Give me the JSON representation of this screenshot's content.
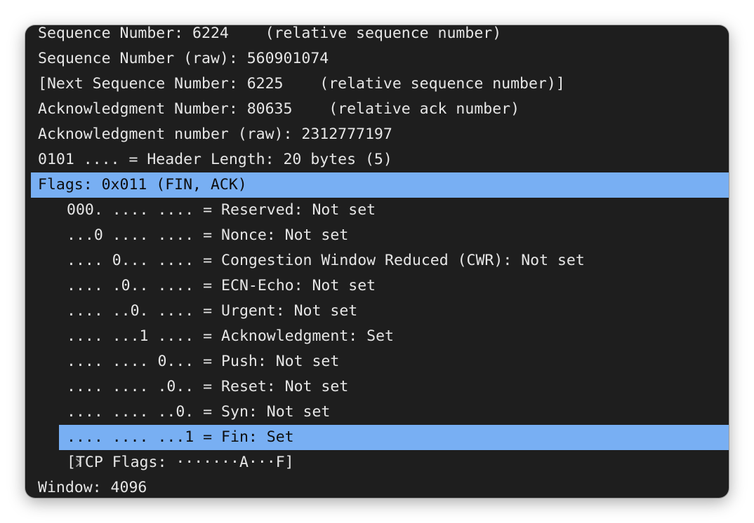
{
  "rows": [
    {
      "text": "Sequence Number: 6224    (relative sequence number)"
    },
    {
      "text": "Sequence Number (raw): 560901074"
    },
    {
      "text": "[Next Sequence Number: 6225    (relative sequence number)]"
    },
    {
      "text": "Acknowledgment Number: 80635    (relative ack number)"
    },
    {
      "text": "Acknowledgment number (raw): 2312777197"
    },
    {
      "text": "0101 .... = Header Length: 20 bytes (5)"
    },
    {
      "text": "Flags: 0x011 (FIN, ACK)"
    },
    {
      "text": "000. .... .... = Reserved: Not set"
    },
    {
      "text": "...0 .... .... = Nonce: Not set"
    },
    {
      "text": ".... 0... .... = Congestion Window Reduced (CWR): Not set"
    },
    {
      "text": ".... .0.. .... = ECN-Echo: Not set"
    },
    {
      "text": ".... ..0. .... = Urgent: Not set"
    },
    {
      "text": ".... ...1 .... = Acknowledgment: Set"
    },
    {
      "text": ".... .... 0... = Push: Not set"
    },
    {
      "text": ".... .... .0.. = Reset: Not set"
    },
    {
      "text": ".... .... ..0. = Syn: Not set"
    },
    {
      "text": ".... .... ...1 = Fin: Set"
    },
    {
      "text": "[TCP Flags: ·······A···F]"
    },
    {
      "text": "Window: 4096"
    }
  ],
  "colors": {
    "background": "#1e1e1e",
    "text": "#e6e6e6",
    "selection": "#78aff3",
    "selected_text": "#0d0d0d"
  },
  "icons": {
    "expander": "chevron-right-icon"
  }
}
